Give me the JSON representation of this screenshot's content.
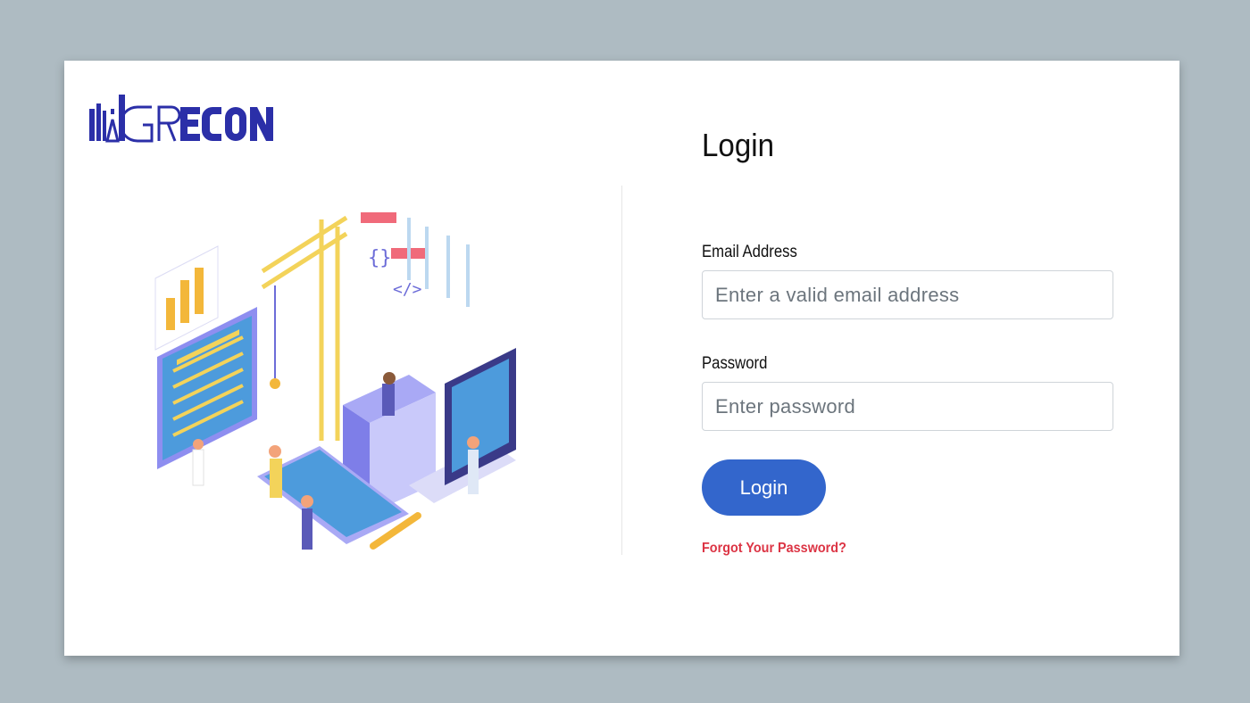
{
  "brand": {
    "name": "GRECON",
    "primary_color": "#2b2fa8",
    "accent_color": "#3366cc"
  },
  "login": {
    "title": "Login",
    "email_label": "Email Address",
    "email_placeholder": "Enter a valid email address",
    "email_value": "",
    "password_label": "Password",
    "password_placeholder": "Enter password",
    "password_value": "",
    "submit_label": "Login",
    "forgot_label": "Forgot Your Password?",
    "forgot_color": "#dc3545"
  },
  "illustration": {
    "icon": "web-development-isometric-illustration"
  }
}
